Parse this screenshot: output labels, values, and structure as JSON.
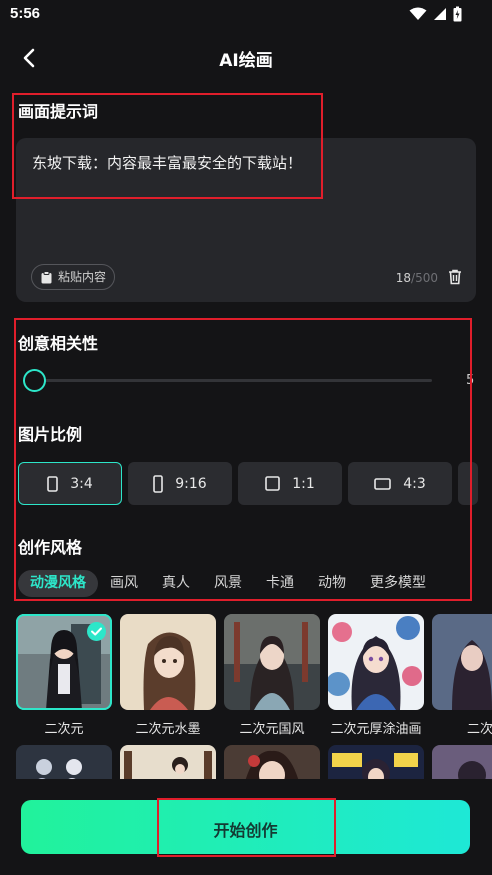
{
  "status": {
    "time": "5:56"
  },
  "header": {
    "title": "AI绘画"
  },
  "prompt": {
    "label": "画面提示词",
    "text": "东坡下载：内容最丰富最安全的下载站！",
    "paste_label": "粘贴内容",
    "count": "18",
    "max": "/500"
  },
  "relevance": {
    "label": "创意相关性",
    "value_text": "5",
    "level": 0
  },
  "ratio": {
    "label": "图片比例",
    "options": [
      {
        "label": "3:4",
        "selected": true
      },
      {
        "label": "9:16",
        "selected": false
      },
      {
        "label": "1:1",
        "selected": false
      },
      {
        "label": "4:3",
        "selected": false
      }
    ]
  },
  "style": {
    "label": "创作风格",
    "tabs": [
      "动漫风格",
      "画风",
      "真人",
      "风景",
      "卡通",
      "动物",
      "更多模型"
    ],
    "active_tab": 0,
    "items": [
      {
        "name": "二次元",
        "selected": true
      },
      {
        "name": "二次元水墨",
        "selected": false
      },
      {
        "name": "二次元国风",
        "selected": false
      },
      {
        "name": "二次元厚涂油画",
        "selected": false
      },
      {
        "name": "二次",
        "selected": false
      }
    ]
  },
  "start_button": {
    "label": "开始创作"
  },
  "colors": {
    "accent": "#2de6c9",
    "bg": "#141416",
    "card": "#26272b",
    "highlight": "#e01e2b"
  }
}
